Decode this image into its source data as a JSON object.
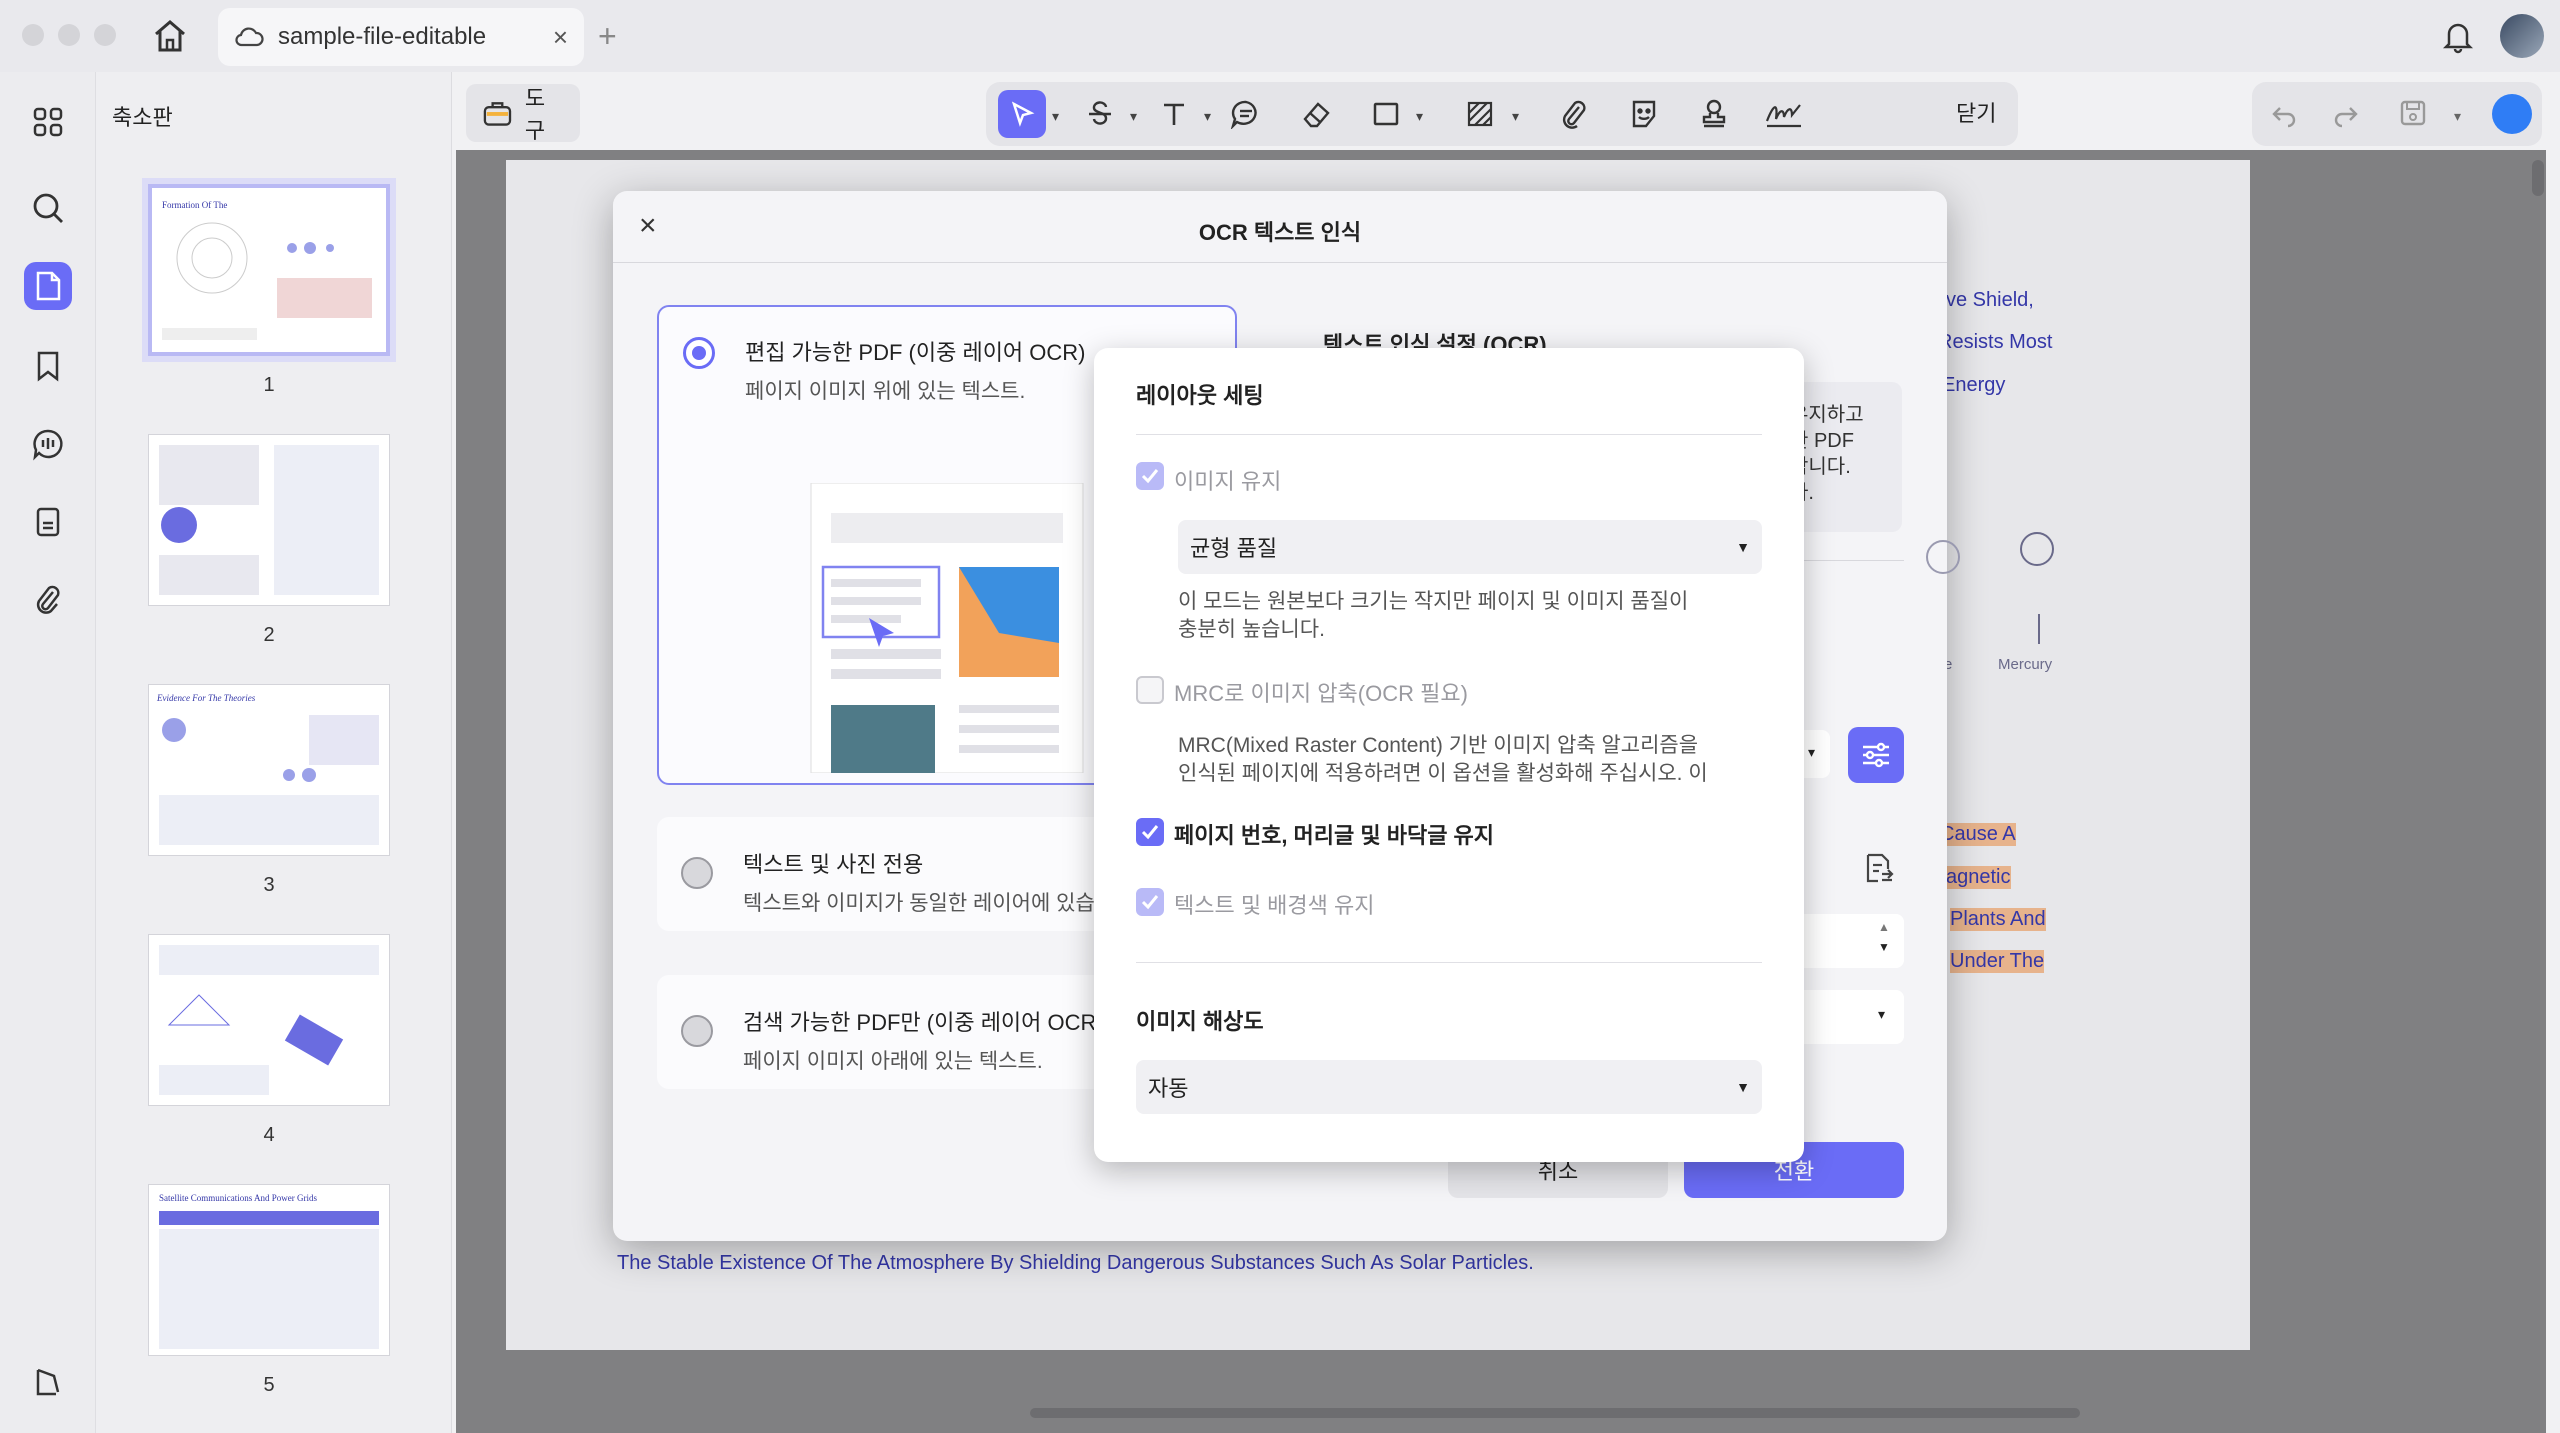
{
  "titlebar": {
    "tab_title": "sample-file-editable",
    "tab_close": "×",
    "new_tab": "+"
  },
  "sidebar": {
    "title": "축소판",
    "page_numbers": [
      "1",
      "2",
      "3",
      "4",
      "5"
    ]
  },
  "toolbar": {
    "tools_label": "도구",
    "close_label": "닫기"
  },
  "document": {
    "right_texts": [
      "ve Shield,",
      "Resists Most",
      "Energy"
    ],
    "planet_labels": [
      "Mercury",
      "e"
    ],
    "highlight_texts": [
      "Cause A",
      "agnetic",
      "Plants And",
      "Under The"
    ],
    "bottom_text": "The Stable Existence Of The Atmosphere By Shielding Dangerous Substances Such As Solar Particles."
  },
  "ocr_dialog": {
    "title": "OCR 텍스트 인식",
    "close": "×",
    "options": [
      {
        "title": "편집 가능한 PDF (이중 레이어 OCR)",
        "desc": "페이지 이미지 위에 있는 텍스트.",
        "selected": true
      },
      {
        "title": "텍스트 및 사진 전용",
        "desc": "텍스트와 이미지가 동일한 레이어에 있습니",
        "selected": false
      },
      {
        "title": "검색 가능한 PDF만 (이중 레이어 OCR)",
        "desc": "페이지 이미지 아래에 있는 텍스트.",
        "selected": false
      }
    ],
    "settings_heading": "텍스트 인식 설정 (OCR)",
    "settings_box_text": "유지하고\n한 PDF\n합니다.\n다.",
    "cancel_label": "취소",
    "convert_label": "전환"
  },
  "layout_popover": {
    "title": "레이아웃 세팅",
    "keep_images": {
      "label": "이미지 유지",
      "checked": true,
      "disabled": true
    },
    "quality_select": "균형 품질",
    "quality_note": [
      "이 모드는 원본보다 크기는 작지만 페이지 및 이미지 품질이",
      "충분히 높습니다."
    ],
    "mrc": {
      "label": "MRC로 이미지 압축(OCR 필요)",
      "checked": false
    },
    "mrc_note": [
      "MRC(Mixed Raster Content) 기반 이미지 압축 알고리즘을",
      "인식된 페이지에 적용하려면 이 옵션을 활성화해 주십시오. 이"
    ],
    "keep_page_numbers": {
      "label": "페이지 번호, 머리글 및 바닥글 유지",
      "checked": true
    },
    "keep_text_bg": {
      "label": "텍스트 및 배경색 유지",
      "checked": true,
      "disabled": true
    },
    "resolution_heading": "이미지 해상도",
    "resolution_select": "자동"
  },
  "colors": {
    "accent": "#6a6cf6",
    "doc_text": "#3437a8",
    "highlight": "#e7b38c"
  }
}
